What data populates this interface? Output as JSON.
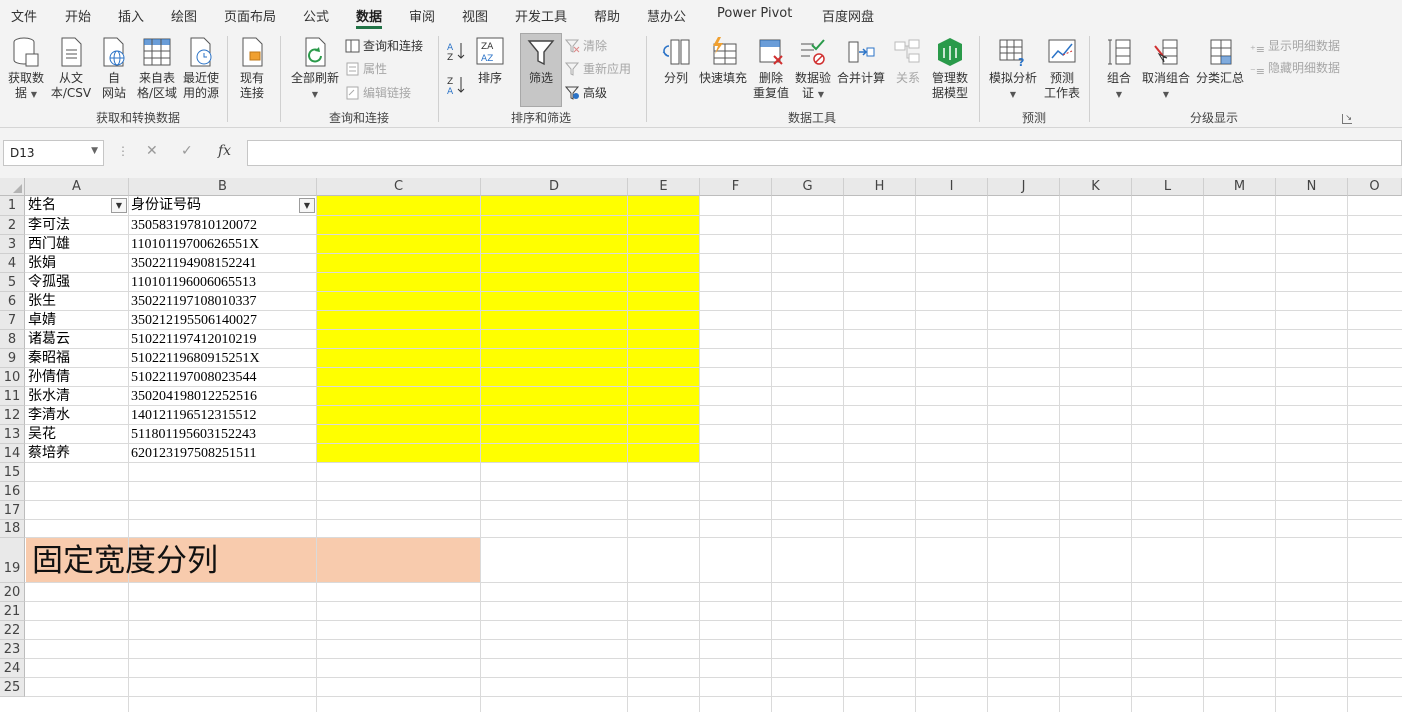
{
  "menu": {
    "tabs": [
      "文件",
      "开始",
      "插入",
      "绘图",
      "页面布局",
      "公式",
      "数据",
      "审阅",
      "视图",
      "开发工具",
      "帮助",
      "慧办公",
      "Power Pivot",
      "百度网盘"
    ],
    "active": "数据"
  },
  "ribbon": {
    "get_data": {
      "group_label": "获取和转换数据",
      "get_data_l1": "获取数",
      "get_data_l2": "据",
      "from_text_l1": "从文",
      "from_text_l2": "本/CSV",
      "from_web_l1": "自",
      "from_web_l2": "网站",
      "from_table_l1": "来自表",
      "from_table_l2": "格/区域",
      "recent_l1": "最近使",
      "recent_l2": "用的源",
      "existing_l1": "现有",
      "existing_l2": "连接"
    },
    "queries": {
      "group_label": "查询和连接",
      "refresh_all": "全部刷新",
      "queries_connections": "查询和连接",
      "properties": "属性",
      "edit_links": "编辑链接"
    },
    "sort_filter": {
      "group_label": "排序和筛选",
      "sort": "排序",
      "filter": "筛选",
      "clear": "清除",
      "reapply": "重新应用",
      "advanced": "高级"
    },
    "data_tools": {
      "group_label": "数据工具",
      "text_to_columns": "分列",
      "flash_fill": "快速填充",
      "remove_dup_l1": "删除",
      "remove_dup_l2": "重复值",
      "validation_l1": "数据验",
      "validation_l2": "证",
      "consolidate": "合并计算",
      "relationships": "关系",
      "data_model_l1": "管理数",
      "data_model_l2": "据模型"
    },
    "forecast": {
      "group_label": "预测",
      "what_if": "模拟分析",
      "sheet_l1": "预测",
      "sheet_l2": "工作表"
    },
    "outline": {
      "group_label": "分级显示",
      "group": "组合",
      "ungroup": "取消组合",
      "subtotal": "分类汇总",
      "show_detail": "显示明细数据",
      "hide_detail": "隐藏明细数据"
    }
  },
  "formula_bar": {
    "name_box": "D13",
    "cancel_icon": "✕",
    "enter_icon": "✓",
    "fx_label": "fx",
    "formula": ""
  },
  "sheet": {
    "columns": [
      "A",
      "B",
      "C",
      "D",
      "E",
      "F",
      "G",
      "H",
      "I",
      "J",
      "K",
      "L",
      "M",
      "N",
      "O"
    ],
    "rows": [
      "1",
      "2",
      "3",
      "4",
      "5",
      "6",
      "7",
      "8",
      "9",
      "10",
      "11",
      "12",
      "13",
      "14",
      "15",
      "16",
      "17",
      "18",
      "19",
      "20",
      "21",
      "22",
      "23",
      "24",
      "25"
    ],
    "header": {
      "name": "姓名",
      "id": "身份证号码"
    },
    "records": [
      {
        "name": "李可法",
        "id": "350583197810120072"
      },
      {
        "name": "西门雄",
        "id": "11010119700626551X"
      },
      {
        "name": "张娟",
        "id": "350221194908152241"
      },
      {
        "name": "令孤强",
        "id": "110101196006065513"
      },
      {
        "name": "张生",
        "id": "350221197108010337"
      },
      {
        "name": "卓婧",
        "id": "350212195506140027"
      },
      {
        "name": "诸葛云",
        "id": "510221197412010219"
      },
      {
        "name": "秦昭福",
        "id": "51022119680915251X"
      },
      {
        "name": "孙倩倩",
        "id": "510221197008023544"
      },
      {
        "name": "张水清",
        "id": "350204198012252516"
      },
      {
        "name": "李清水",
        "id": "140121196512315512"
      },
      {
        "name": "吴花",
        "id": "511801195603152243"
      },
      {
        "name": "蔡培养",
        "id": "620123197508251511"
      }
    ],
    "banner_text": "固定宽度分列",
    "colors": {
      "yellow_fill": "#ffff00",
      "banner_fill": "#f8cbad",
      "accent": "#217346"
    }
  }
}
